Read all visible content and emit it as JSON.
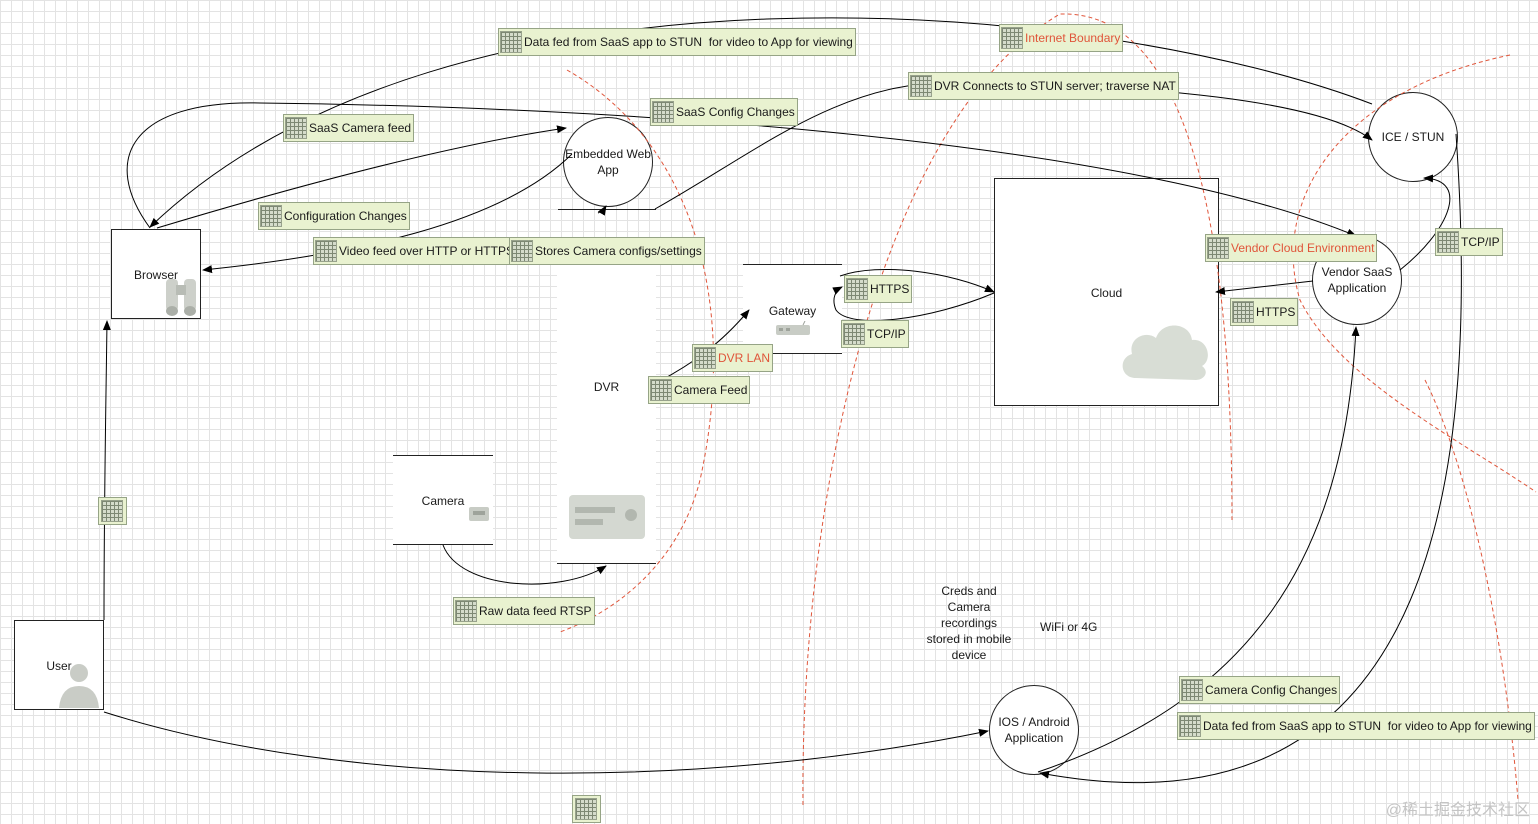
{
  "nodes": {
    "browser": "Browser",
    "user": "User",
    "embedded_web_app": "Embedded Web App",
    "gateway": "Gateway",
    "dvr": "DVR",
    "camera": "Camera",
    "cloud": "Cloud",
    "ice_stun": "ICE / STUN",
    "vendor_saas": "Vendor SaaS Application",
    "mobile_app": "IOS / Android Application"
  },
  "notes": {
    "mobile_storage": "Creds and Camera recordings stored in mobile device",
    "network": "WiFi or 4G"
  },
  "flow_labels": [
    "Data fed from SaaS app to STUN  for video to App for viewing",
    "DVR Connects to STUN server; traverse NAT",
    "SaaS Config Changes",
    "SaaS Camera feed",
    "Configuration Changes",
    "Video feed over HTTP or HTTPS",
    "Stores Camera configs/settings",
    "TCP/IP",
    "HTTPS",
    "TCP/IP",
    "HTTPS",
    "Camera Feed",
    "Raw data feed RTSP",
    "Camera Config Changes",
    "Data fed from SaaS app to STUN  for video to App for viewing"
  ],
  "boundary_labels": [
    "Internet Boundary",
    "Vendor Cloud Environment",
    "DVR LAN"
  ],
  "icons": {
    "flow": "network-flow-icon",
    "browser": "binoculars-icon",
    "user": "person-icon",
    "cloud": "cloud-icon",
    "gateway": "router-icon",
    "camera": "camera-icon",
    "dvr": "dvr-icon"
  },
  "colors": {
    "boundary": "#e0553a",
    "label_fill": "#e9f2d0",
    "label_border": "#96a486",
    "line": "#000000",
    "grid": "#e3e3e3"
  },
  "watermark": "@稀土掘金技术社区"
}
